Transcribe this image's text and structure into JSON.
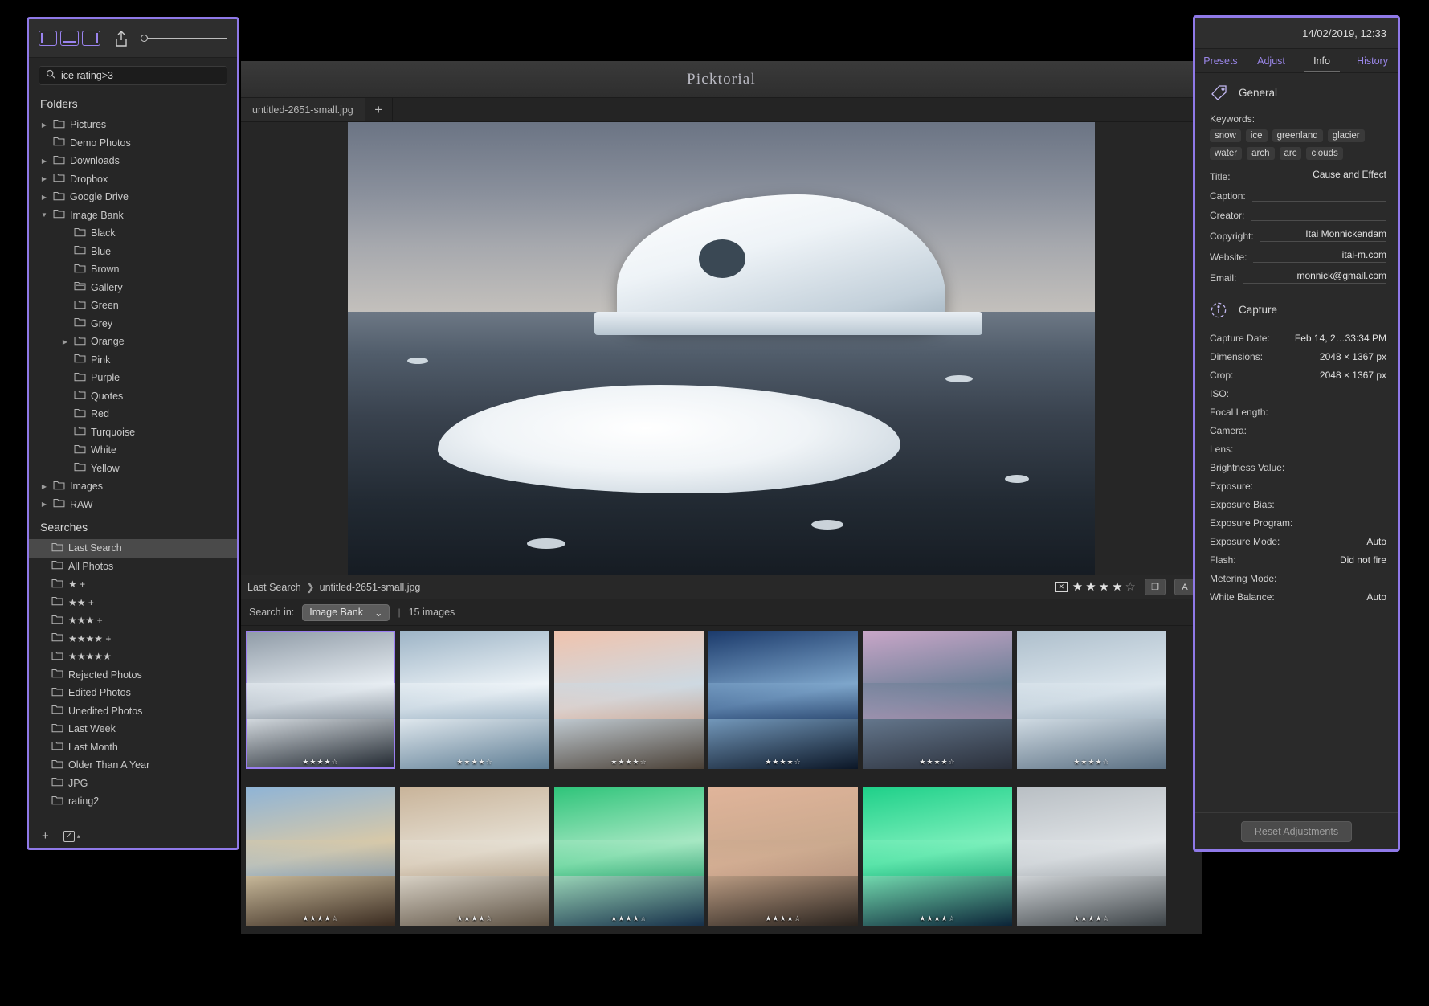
{
  "app": {
    "title": "Picktorial",
    "file_tab": "untitled-2651-small.jpg",
    "tab_add": "+"
  },
  "left_panel": {
    "toolbar": {
      "layout_one": "layout-single",
      "layout_two": "layout-filmstrip",
      "layout_three": "layout-split",
      "share": "share",
      "zoom_value": "0"
    },
    "search": {
      "value": "ice rating>3",
      "placeholder": "Search",
      "icon": "search-icon"
    },
    "folders_title": "Folders",
    "folders": [
      {
        "label": "Pictures",
        "indent": 1,
        "disclosure": "collapsed"
      },
      {
        "label": "Demo Photos",
        "indent": 1,
        "disclosure": "none"
      },
      {
        "label": "Downloads",
        "indent": 1,
        "disclosure": "collapsed"
      },
      {
        "label": "Dropbox",
        "indent": 1,
        "disclosure": "collapsed"
      },
      {
        "label": "Google Drive",
        "indent": 1,
        "disclosure": "collapsed"
      },
      {
        "label": "Image Bank",
        "indent": 1,
        "disclosure": "expanded"
      },
      {
        "label": "Black",
        "indent": 2,
        "disclosure": "none"
      },
      {
        "label": "Blue",
        "indent": 2,
        "disclosure": "none"
      },
      {
        "label": "Brown",
        "indent": 2,
        "disclosure": "none"
      },
      {
        "label": "Gallery",
        "indent": 2,
        "disclosure": "none",
        "icon": "gallery-folder-icon"
      },
      {
        "label": "Green",
        "indent": 2,
        "disclosure": "none"
      },
      {
        "label": "Grey",
        "indent": 2,
        "disclosure": "none"
      },
      {
        "label": "Orange",
        "indent": 2,
        "disclosure": "collapsed"
      },
      {
        "label": "Pink",
        "indent": 2,
        "disclosure": "none"
      },
      {
        "label": "Purple",
        "indent": 2,
        "disclosure": "none"
      },
      {
        "label": "Quotes",
        "indent": 2,
        "disclosure": "none"
      },
      {
        "label": "Red",
        "indent": 2,
        "disclosure": "none"
      },
      {
        "label": "Turquoise",
        "indent": 2,
        "disclosure": "none"
      },
      {
        "label": "White",
        "indent": 2,
        "disclosure": "none"
      },
      {
        "label": "Yellow",
        "indent": 2,
        "disclosure": "none"
      },
      {
        "label": "Images",
        "indent": 1,
        "disclosure": "collapsed"
      },
      {
        "label": "RAW",
        "indent": 1,
        "disclosure": "collapsed"
      }
    ],
    "searches_title": "Searches",
    "searches": [
      {
        "label": "Last Search",
        "selected": true
      },
      {
        "label": "All Photos",
        "selected": false
      },
      {
        "label": "★ +",
        "selected": false
      },
      {
        "label": "★★ +",
        "selected": false
      },
      {
        "label": "★★★ +",
        "selected": false
      },
      {
        "label": "★★★★ +",
        "selected": false
      },
      {
        "label": "★★★★★",
        "selected": false
      },
      {
        "label": "Rejected Photos",
        "selected": false
      },
      {
        "label": "Edited Photos",
        "selected": false
      },
      {
        "label": "Unedited Photos",
        "selected": false
      },
      {
        "label": "Last Week",
        "selected": false
      },
      {
        "label": "Last Month",
        "selected": false
      },
      {
        "label": "Older Than A Year",
        "selected": false
      },
      {
        "label": "JPG",
        "selected": false
      },
      {
        "label": "rating2",
        "selected": false
      }
    ],
    "footer": {
      "add": "+",
      "checkbox": "☑",
      "caret": "▾"
    }
  },
  "breadcrumb": {
    "parent": "Last Search",
    "separator": "❯",
    "current": "untitled-2651-small.jpg",
    "flag_icon": "rejected-flag-icon",
    "rating": 4,
    "rating_max": 5,
    "tool_compare": "compare-icon",
    "tool_before_after": "A"
  },
  "filmstrip": {
    "label": "Search in:",
    "folder": "Image Bank",
    "chevron": "⌄",
    "divider": "|",
    "count": "15 images"
  },
  "thumbnails": [
    {
      "name": "iceberg-arch",
      "rating": "★★★★☆",
      "selected": true,
      "c1": "#8e9aa6",
      "c2": "#e8eef3",
      "c3": "#1d242c"
    },
    {
      "name": "ice-cave",
      "rating": "★★★★☆",
      "selected": false,
      "c1": "#9db4c6",
      "c2": "#eef4f8",
      "c3": "#5d7c93"
    },
    {
      "name": "husky-cabin",
      "rating": "★★★★☆",
      "selected": false,
      "c1": "#f0c3ad",
      "c2": "#cdd9e2",
      "c3": "#4a4036"
    },
    {
      "name": "valley-reflection",
      "rating": "★★★★☆",
      "selected": false,
      "c1": "#1b3a6b",
      "c2": "#7fa7cc",
      "c3": "#0b1626"
    },
    {
      "name": "pink-mountain-lake",
      "rating": "★★★★☆",
      "selected": false,
      "c1": "#c9a6c8",
      "c2": "#6b7f96",
      "c3": "#2a2f3a"
    },
    {
      "name": "glacier-lagoon",
      "rating": "★★★★☆",
      "selected": false,
      "c1": "#aebfcc",
      "c2": "#dde7ee",
      "c3": "#5a6f82"
    },
    {
      "name": "horses-shore",
      "rating": "★★★★☆",
      "selected": false,
      "c1": "#8fb4d6",
      "c2": "#d8c9a8",
      "c3": "#3a2b20"
    },
    {
      "name": "lighthouse-ice",
      "rating": "★★★★☆",
      "selected": false,
      "c1": "#c9b49a",
      "c2": "#e6e0d4",
      "c3": "#5e5244"
    },
    {
      "name": "aurora-green",
      "rating": "★★★★☆",
      "selected": false,
      "c1": "#2fc47a",
      "c2": "#a8e8c4",
      "c3": "#17304a"
    },
    {
      "name": "vestrahorn",
      "rating": "★★★★☆",
      "selected": false,
      "c1": "#e0b49a",
      "c2": "#caa98e",
      "c3": "#2a231e"
    },
    {
      "name": "aurora-reflection",
      "rating": "★★★★☆",
      "selected": false,
      "c1": "#1fd089",
      "c2": "#7ef0bd",
      "c3": "#0c2438"
    },
    {
      "name": "sea-stacks",
      "rating": "★★★★☆",
      "selected": false,
      "c1": "#b9bfc4",
      "c2": "#e0e4e7",
      "c3": "#3d4347"
    }
  ],
  "right_panel": {
    "date": "14/02/2019, 12:33",
    "tabs": [
      {
        "label": "Presets",
        "active": false
      },
      {
        "label": "Adjust",
        "active": false
      },
      {
        "label": "Info",
        "active": true
      },
      {
        "label": "History",
        "active": false
      }
    ],
    "general": {
      "icon": "tag-icon",
      "title": "General",
      "keywords_label": "Keywords:",
      "keywords": [
        "snow",
        "ice",
        "greenland",
        "glacier",
        "water",
        "arch",
        "arc",
        "clouds"
      ],
      "fields": [
        {
          "label": "Title:",
          "value": "Cause and  Effect"
        },
        {
          "label": "Caption:",
          "value": ""
        },
        {
          "label": "Creator:",
          "value": ""
        },
        {
          "label": "Copyright:",
          "value": "Itai Monnickendam"
        },
        {
          "label": "Website:",
          "value": "itai-m.com"
        },
        {
          "label": "Email:",
          "value": "monnick@gmail.com"
        }
      ]
    },
    "capture": {
      "icon": "info-icon",
      "title": "Capture",
      "fields": [
        {
          "label": "Capture Date:",
          "value": "Feb 14, 2…33:34 PM"
        },
        {
          "label": "Dimensions:",
          "value": "2048 × 1367 px"
        },
        {
          "label": "Crop:",
          "value": "2048 × 1367 px"
        },
        {
          "label": "ISO:",
          "value": ""
        },
        {
          "label": "Focal Length:",
          "value": ""
        },
        {
          "label": "Camera:",
          "value": ""
        },
        {
          "label": "Lens:",
          "value": ""
        },
        {
          "label": "Brightness Value:",
          "value": ""
        },
        {
          "label": "Exposure:",
          "value": ""
        },
        {
          "label": "Exposure Bias:",
          "value": ""
        },
        {
          "label": "Exposure Program:",
          "value": ""
        },
        {
          "label": "Exposure Mode:",
          "value": "Auto"
        },
        {
          "label": "Flash:",
          "value": "Did not fire"
        },
        {
          "label": "Metering Mode:",
          "value": ""
        },
        {
          "label": "White Balance:",
          "value": "Auto"
        }
      ]
    },
    "reset_label": "Reset Adjustments"
  },
  "colors": {
    "highlight": "#8f79e8",
    "panel_bg": "#262626",
    "app_bg": "#232323",
    "accent_link": "#9a86e8"
  }
}
